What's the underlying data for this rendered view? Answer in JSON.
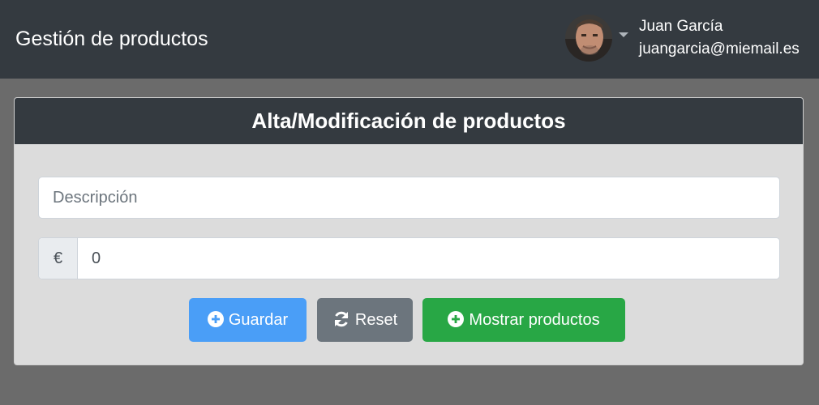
{
  "header": {
    "title": "Gestión de productos",
    "user": {
      "name": "Juan García",
      "email": "juangarcia@miemail.es",
      "avatar_icon": "user-avatar-photo"
    }
  },
  "form": {
    "title": "Alta/Modificación de productos",
    "description": {
      "placeholder": "Descripción",
      "value": ""
    },
    "price": {
      "currency_symbol": "€",
      "value": "0"
    },
    "buttons": {
      "save": {
        "label": "Guardar",
        "icon": "plus-circle-icon"
      },
      "reset": {
        "label": "Reset",
        "icon": "refresh-icon"
      },
      "show": {
        "label": "Mostrar productos",
        "icon": "plus-circle-icon"
      }
    }
  },
  "colors": {
    "navbar": "#343a40",
    "background": "#6b6b6b",
    "card": "#dcdcdc",
    "primary": "#4a9ef7",
    "secondary": "#6c757d",
    "success": "#28a745"
  }
}
